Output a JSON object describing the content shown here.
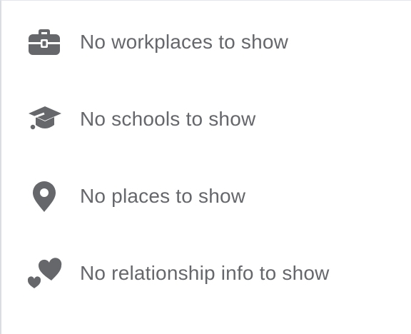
{
  "intro_items": [
    {
      "icon": "briefcase-icon",
      "text": "No workplaces to show"
    },
    {
      "icon": "graduation-cap-icon",
      "text": "No schools to show"
    },
    {
      "icon": "map-pin-icon",
      "text": "No places to show"
    },
    {
      "icon": "hearts-icon",
      "text": "No relationship info to show"
    }
  ],
  "colors": {
    "icon": "#65676b",
    "text": "#65676b",
    "background": "#ffffff"
  }
}
